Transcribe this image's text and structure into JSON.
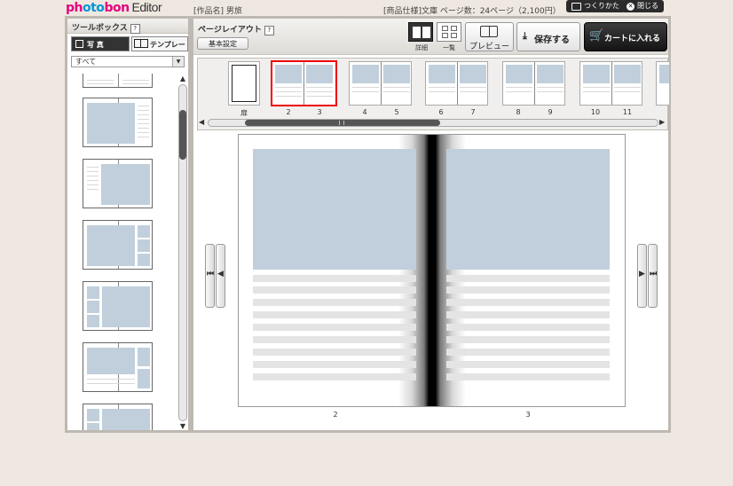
{
  "header": {
    "logo_a": "ph",
    "logo_b": "oto",
    "logo_c": "bon",
    "logo_d": "Editor",
    "work_name": "[作品名] 男旅",
    "product_spec": "[商品仕様]文庫 ページ数：24ページ（2,100円）",
    "howto_label": "つくりかた",
    "close_label": "閉じる"
  },
  "toolbox": {
    "title": "ツールボックス",
    "help": "?",
    "tab_photo": "写 真",
    "tab_template": "テンプレート",
    "filter_value": "すべて"
  },
  "layout": {
    "title": "ページレイアウト",
    "help": "?",
    "basic_settings": "基本設定",
    "view_detail": "詳細",
    "view_list": "一覧",
    "preview": "プレビュー",
    "save": "保存する",
    "cart": "カートに入れる"
  },
  "thumbnails": [
    {
      "label_left": "扉",
      "label_right": "",
      "selected": false
    },
    {
      "label_left": "2",
      "label_right": "3",
      "selected": true
    },
    {
      "label_left": "4",
      "label_right": "5",
      "selected": false
    },
    {
      "label_left": "6",
      "label_right": "7",
      "selected": false
    },
    {
      "label_left": "8",
      "label_right": "9",
      "selected": false
    },
    {
      "label_left": "10",
      "label_right": "11",
      "selected": false
    }
  ],
  "spread": {
    "left_page": "2",
    "right_page": "3"
  },
  "colors": {
    "accent": "#e4007f",
    "logo_blue": "#0095d9",
    "photo_placeholder": "#c0cfdb",
    "selected_border": "#ee0000"
  }
}
